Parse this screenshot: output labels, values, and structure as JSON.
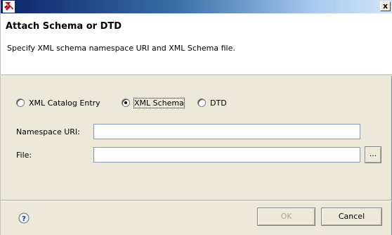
{
  "window": {
    "close_glyph": "x",
    "app_icon": "eclipse-app-icon"
  },
  "header": {
    "title": "Attach Schema or DTD",
    "description": "Specify XML schema namespace URI and XML Schema file."
  },
  "source_options": {
    "items": [
      {
        "label": "XML Catalog Entry",
        "selected": false
      },
      {
        "label": "XML Schema",
        "selected": true
      },
      {
        "label": "DTD",
        "selected": false
      }
    ]
  },
  "form": {
    "namespace_label": "Namespace URI:",
    "namespace_value": "",
    "file_label": "File:",
    "file_value": "",
    "browse_label": "..."
  },
  "footer": {
    "help_icon": "help-icon",
    "ok_label": "OK",
    "ok_enabled": false,
    "cancel_label": "Cancel"
  },
  "colors": {
    "titlebar_start": "#0a246a",
    "titlebar_end": "#d4e4f7",
    "dialog_background": "#ece9d8",
    "header_background": "#ffffff"
  }
}
